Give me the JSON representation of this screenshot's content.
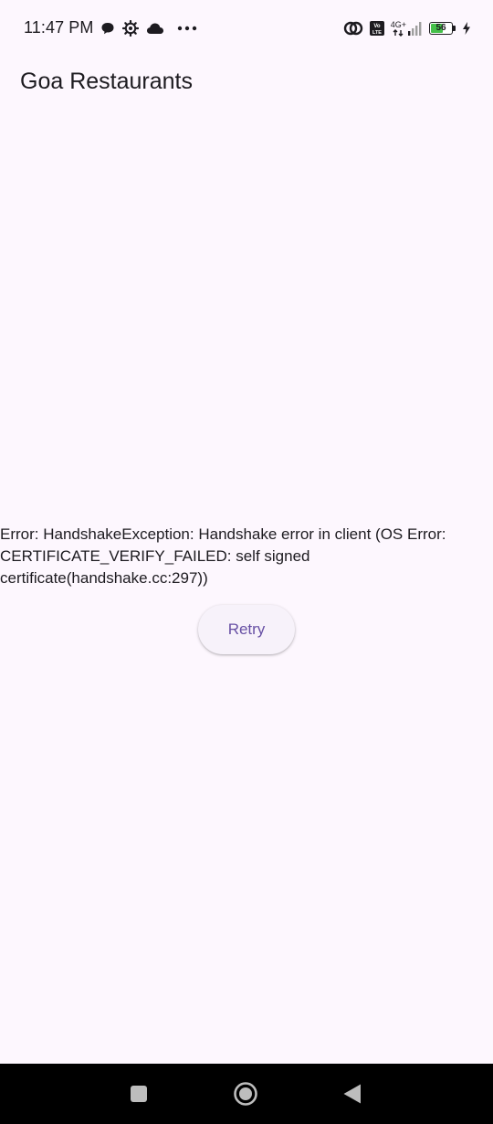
{
  "status_bar": {
    "time": "11:47 PM",
    "network_label": "4G+",
    "battery_level": "56",
    "battery_fraction": 0.56,
    "left_icons": [
      "chat-bubble-icon",
      "settings-gear-icon",
      "cloud-icon",
      "more-dots-icon"
    ],
    "right_icons": [
      "hotspot-icon",
      "volte-icon",
      "signal-icon",
      "battery-icon",
      "charging-icon"
    ]
  },
  "app_bar": {
    "title": "Goa Restaurants"
  },
  "main": {
    "error_message": "Error: HandshakeException: Handshake error in client (OS Error: \n CERTIFICATE_VERIFY_FAILED: self signed\ncertificate(handshake.cc:297))",
    "retry_label": "Retry"
  },
  "nav_bar": {
    "buttons": [
      "recent-apps-icon",
      "home-icon",
      "back-icon"
    ]
  },
  "colors": {
    "background": "#fdf7fe",
    "primary": "#6750a4",
    "button_surface": "#f7f2fa",
    "text": "#1d1b20",
    "nav_bar": "#000000"
  }
}
